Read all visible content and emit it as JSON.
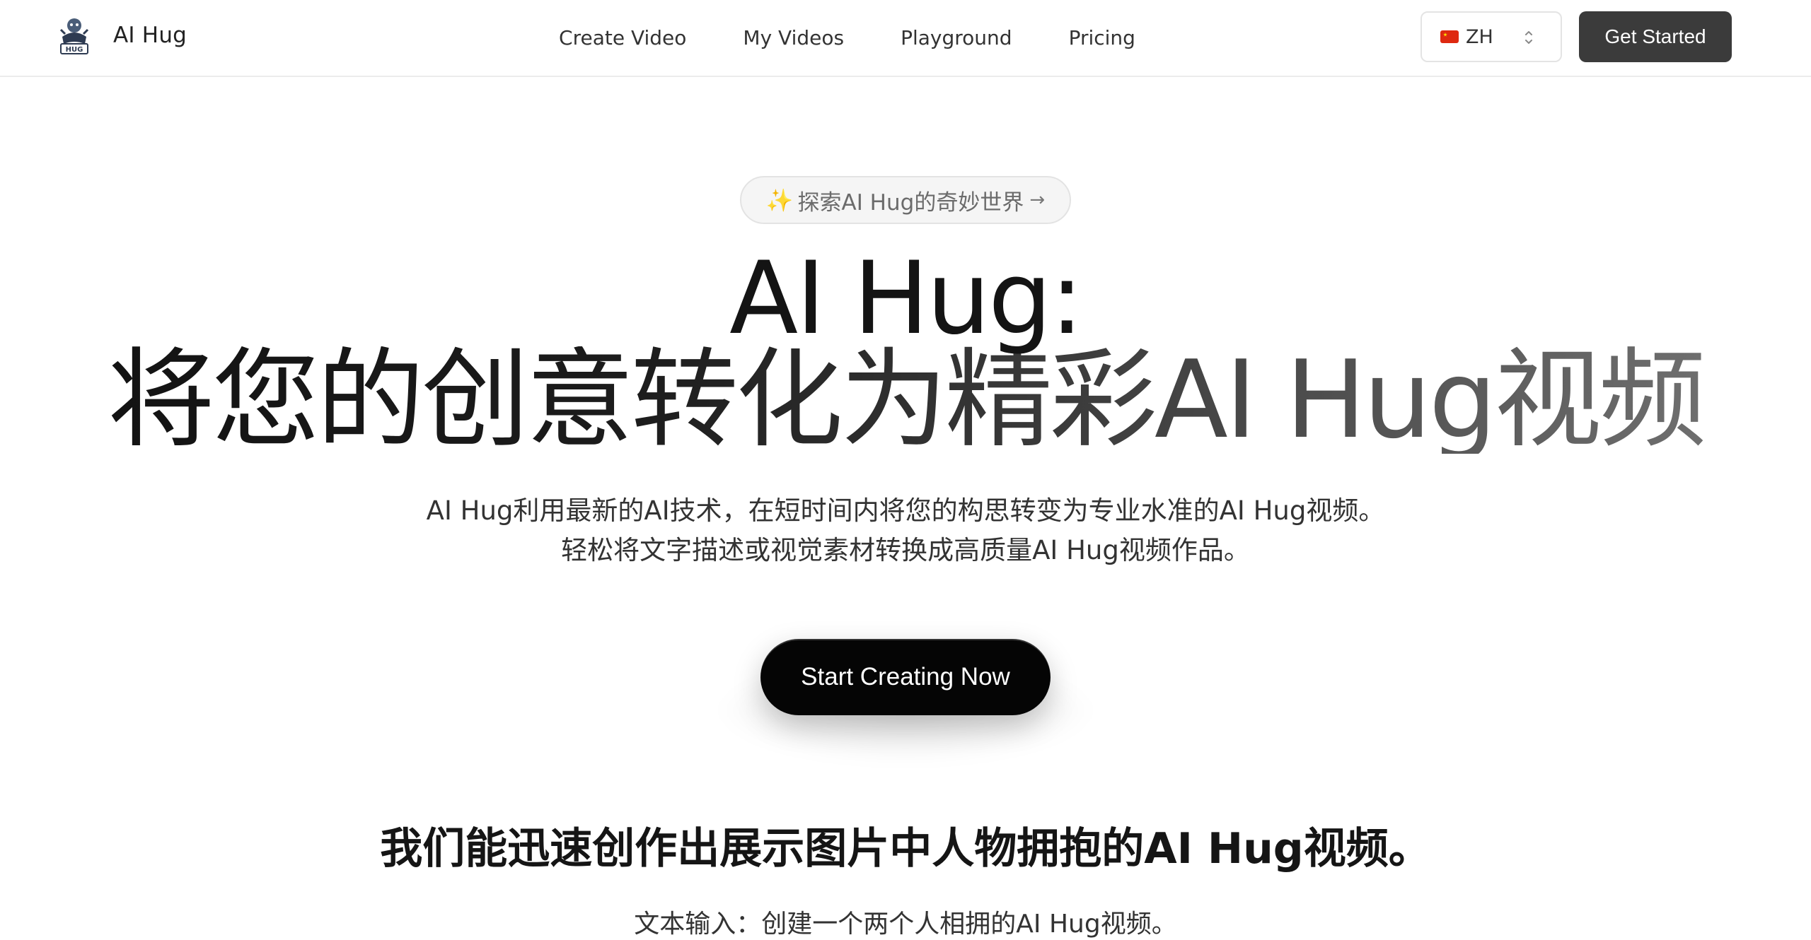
{
  "header": {
    "brand": "AI Hug",
    "logo_icon": "hug-mascot-logo",
    "nav": [
      {
        "label": "Create Video"
      },
      {
        "label": "My Videos"
      },
      {
        "label": "Playground"
      },
      {
        "label": "Pricing"
      }
    ],
    "language": {
      "flag": "china-flag-icon",
      "code": "ZH"
    },
    "get_started": "Get Started"
  },
  "hero": {
    "badge": {
      "sparkle": "✨",
      "text": "探索AI Hug的奇妙世界",
      "arrow": "→"
    },
    "title_line1": "AI Hug:",
    "title_line2": "将您的创意转化为精彩AI Hug视频",
    "subtitle_line1": "AI Hug利用最新的AI技术，在短时间内将您的构思转变为专业水准的AI Hug视频。",
    "subtitle_line2": "轻松将文字描述或视觉素材转换成高质量AI Hug视频作品。",
    "cta": "Start Creating Now"
  },
  "section": {
    "heading": "我们能迅速创作出展示图片中人物拥抱的AI Hug视频。",
    "text": "文本输入：创建一个两个人相拥的AI Hug视频。"
  },
  "colors": {
    "primary_button": "#3b3b3b",
    "cta_button": "#050505",
    "border": "#ececec"
  }
}
